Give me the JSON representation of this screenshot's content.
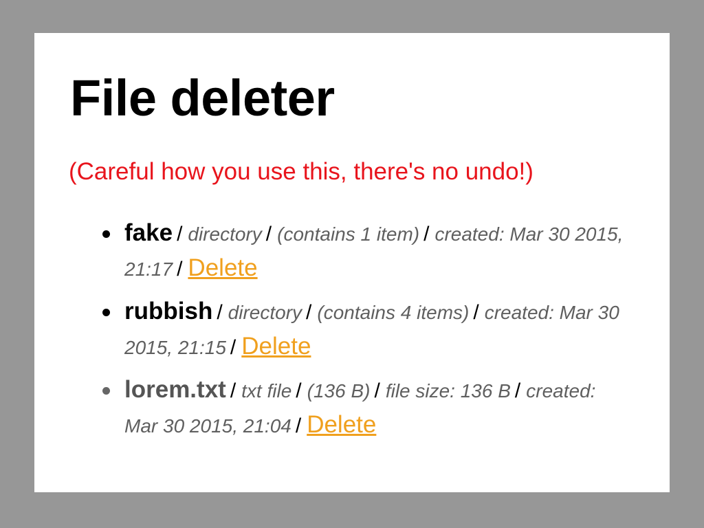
{
  "title": "File deleter",
  "warning": "(Careful how you use this, there's no undo!)",
  "separator": "/",
  "delete_label": "Delete",
  "files": [
    {
      "name": "fake",
      "type": "directory",
      "contents": "(contains 1 item)",
      "created": "created: Mar 30 2015, 21:17"
    },
    {
      "name": "rubbish",
      "type": "directory",
      "contents": "(contains 4 items)",
      "created": "created: Mar 30 2015, 21:15"
    },
    {
      "name": "lorem.txt",
      "type": "txt file",
      "contents": "(136 B)",
      "size": "file size: 136 B",
      "created": "created: Mar 30 2015, 21:04"
    }
  ],
  "colors": {
    "backdrop": "#979797",
    "warning": "#e8141c",
    "link": "#f0a01e",
    "meta": "#5f5f5f"
  }
}
